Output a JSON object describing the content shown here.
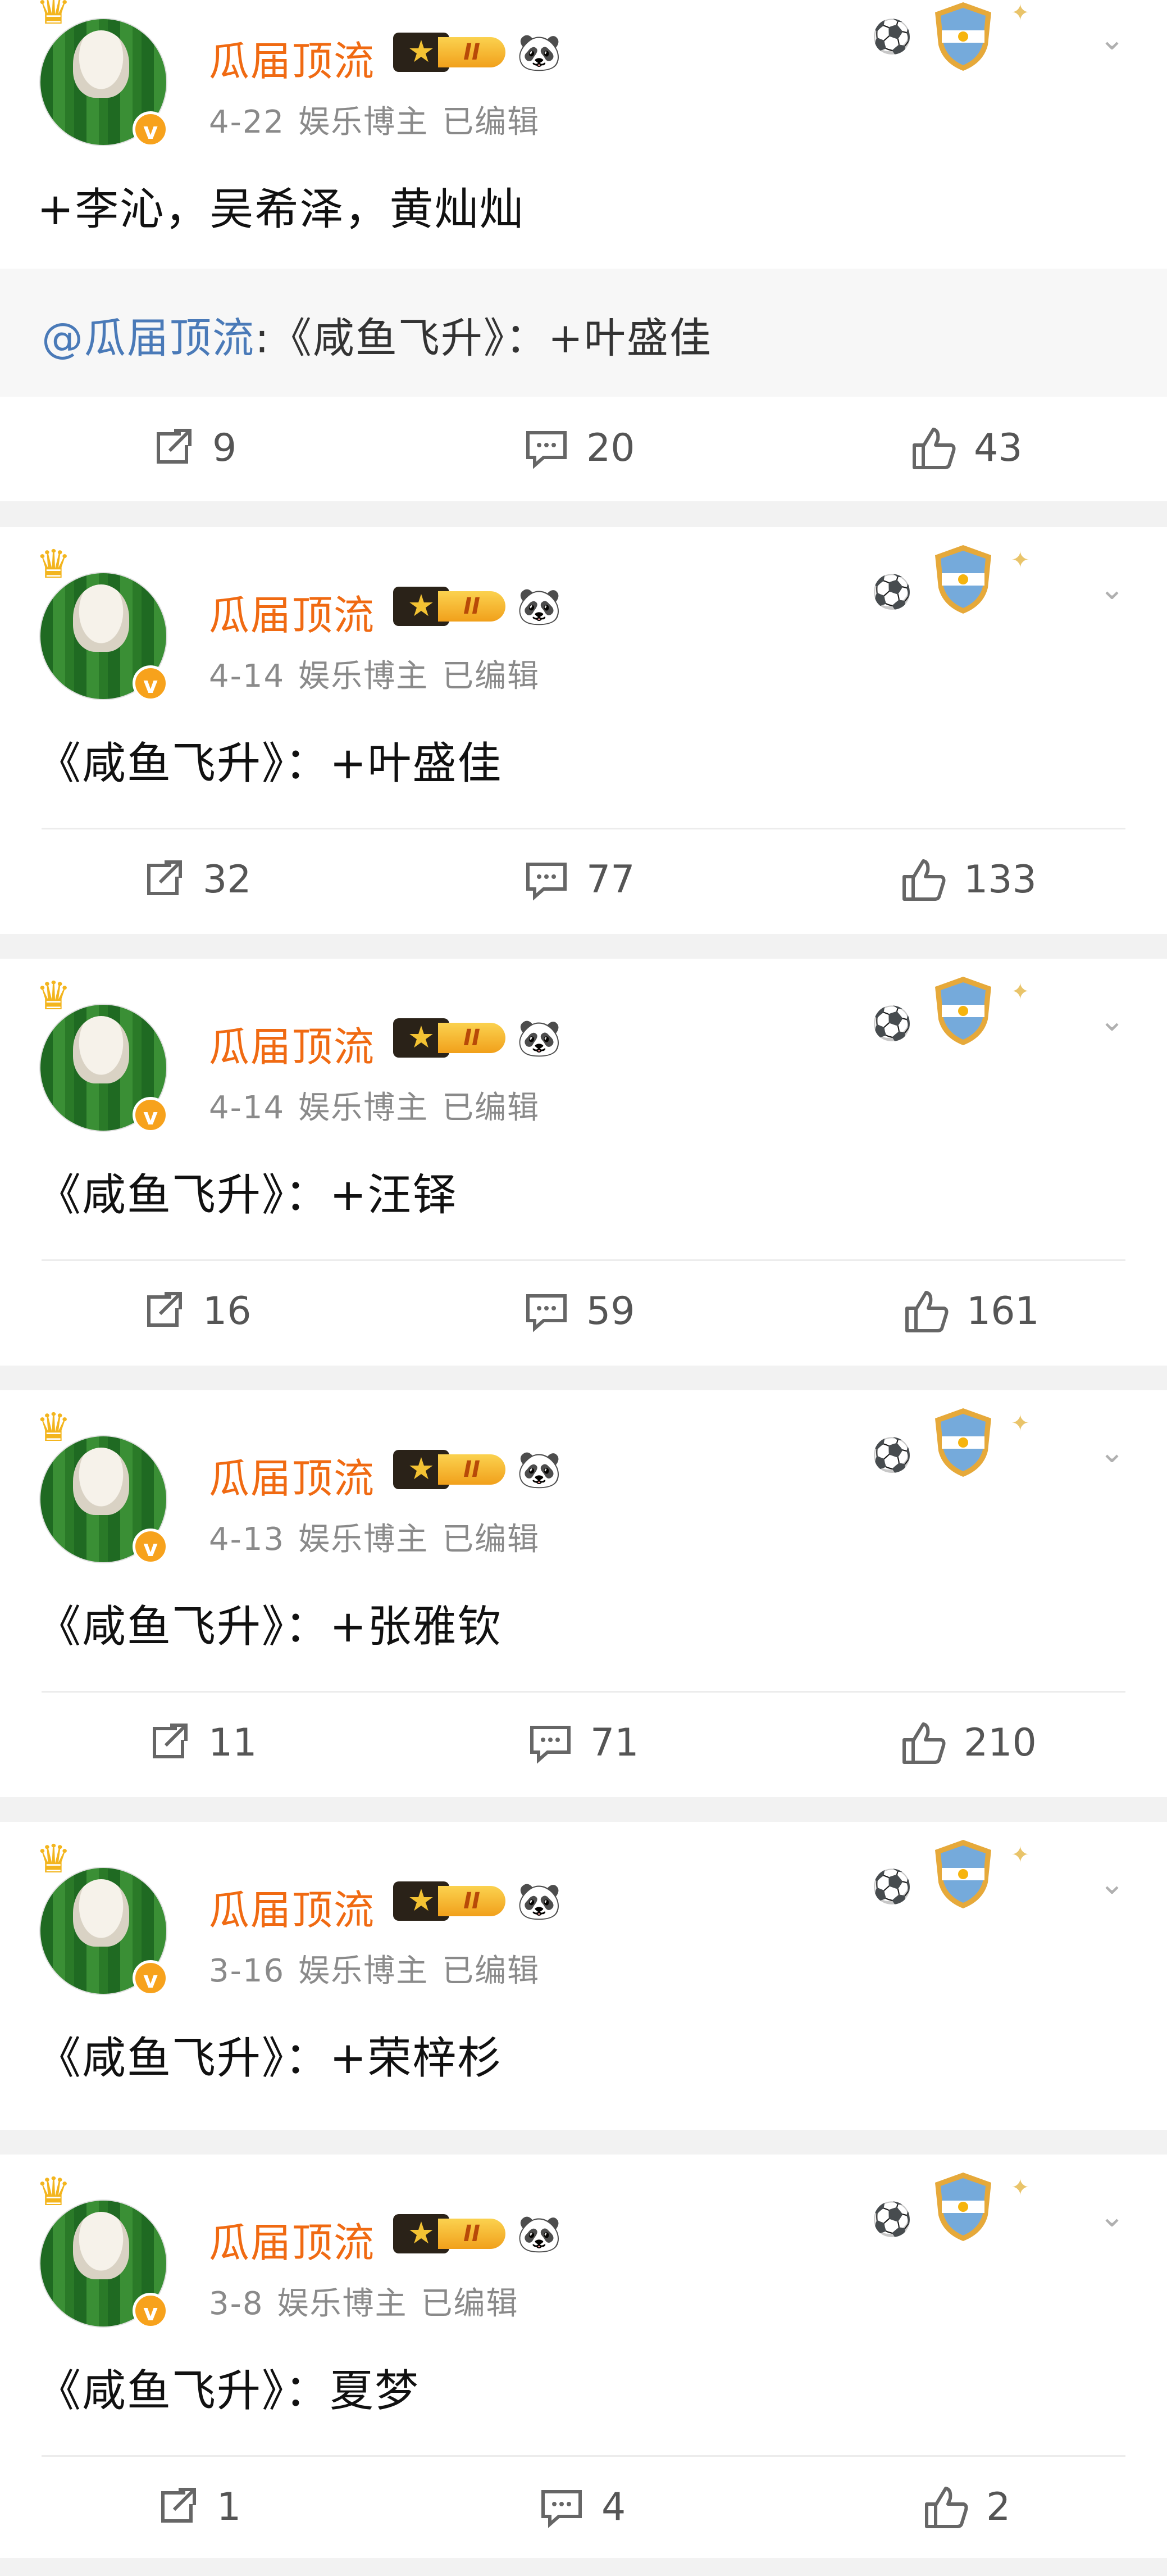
{
  "posts": [
    {
      "author": "瓜届顶流",
      "level_badge": "II",
      "date": "4-22",
      "tag": "娱乐博主",
      "edited": "已编辑",
      "text": "+李沁，吴希泽，黄灿灿",
      "quote": {
        "mention": "@瓜届顶流",
        "text": ":《咸鱼飞升》：+叶盛佳"
      },
      "repost_count": "9",
      "comment_count": "20",
      "like_count": "43"
    },
    {
      "author": "瓜届顶流",
      "level_badge": "II",
      "date": "4-14",
      "tag": "娱乐博主",
      "edited": "已编辑",
      "text": "《咸鱼飞升》：+叶盛佳",
      "repost_count": "32",
      "comment_count": "77",
      "like_count": "133"
    },
    {
      "author": "瓜届顶流",
      "level_badge": "II",
      "date": "4-14",
      "tag": "娱乐博主",
      "edited": "已编辑",
      "text": "《咸鱼飞升》：+汪铎",
      "repost_count": "16",
      "comment_count": "59",
      "like_count": "161"
    },
    {
      "author": "瓜届顶流",
      "level_badge": "II",
      "date": "4-13",
      "tag": "娱乐博主",
      "edited": "已编辑",
      "text": "《咸鱼飞升》：+张雅钦",
      "repost_count": "11",
      "comment_count": "71",
      "like_count": "210"
    },
    {
      "author": "瓜届顶流",
      "level_badge": "II",
      "date": "3-16",
      "tag": "娱乐博主",
      "edited": "已编辑",
      "text": "《咸鱼飞升》：+荣梓杉"
    },
    {
      "author": "瓜届顶流",
      "level_badge": "II",
      "date": "3-8",
      "tag": "娱乐博主",
      "edited": "已编辑",
      "text": "《咸鱼飞升》：夏梦",
      "repost_count": "1",
      "comment_count": "4",
      "like_count": "2"
    }
  ],
  "icons": {
    "crown": "crown-icon",
    "verified": "verified-v-icon",
    "panda": "panda-icon",
    "soccer": "soccer-ball-icon",
    "shield": "argentina-shield-badge-icon",
    "more": "chevron-down-icon",
    "repost": "repost-icon",
    "comment": "comment-icon",
    "like": "thumbs-up-icon"
  },
  "colors": {
    "name": "#f06a12",
    "mention": "#4a7ab8",
    "badge": "#f7a21c"
  }
}
